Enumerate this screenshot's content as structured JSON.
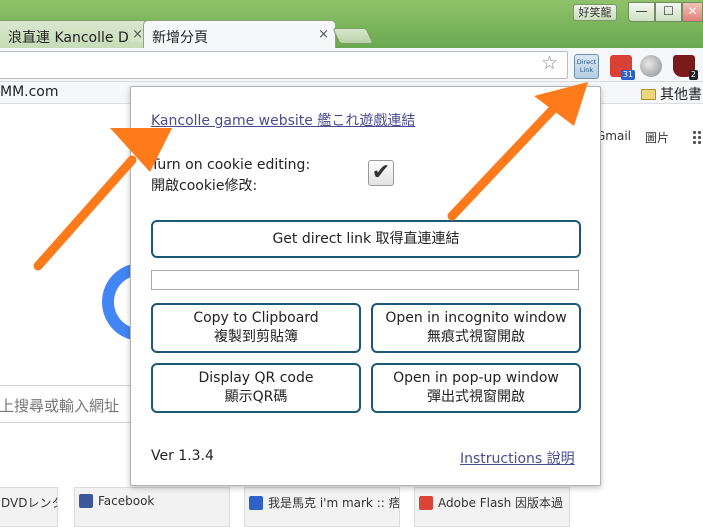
{
  "browser": {
    "tabs": [
      {
        "label": "浪直連 Kancolle D",
        "active": false
      },
      {
        "label": "新增分頁",
        "active": true
      }
    ],
    "user_name": "好笑龍",
    "close_symbol": "×",
    "window_controls": {
      "minimize": "—",
      "maximize": "☐",
      "close": "✕"
    },
    "star_glyph": "☆",
    "extensions": {
      "direct_link": "Direct Link",
      "calendar_badge": "31",
      "ublock_badge": "2"
    },
    "bookmarks": {
      "left_item": "MM.com",
      "right_item": "其他書"
    }
  },
  "new_tab_page": {
    "gmail_link": "Gmail",
    "images_link": "圖片",
    "search_placeholder": "上搜尋或輸入網址",
    "tiles": [
      {
        "label": "DVDレンタ",
        "favicon_color": "#d8d8d8"
      },
      {
        "label": "Facebook",
        "favicon_color": "#3b5998"
      },
      {
        "label": "我是馬克 i'm mark :: 痞",
        "favicon_color": "#2f62c8"
      },
      {
        "label": "Adobe Flash 因版本過",
        "favicon_color": "#db4437"
      }
    ]
  },
  "popup": {
    "title_link": "Kancolle game website 艦これ遊戲連結",
    "cookie_label_en": "Turn on cookie editing:",
    "cookie_label_zh": "開啟cookie修改:",
    "cookie_checked": true,
    "check_glyph": "✔",
    "direct_link_button": "Get direct link 取得直連連結",
    "link_field_value": "",
    "copy_button": {
      "en": "Copy to Clipboard",
      "zh": "複製到剪貼簿"
    },
    "incognito_button": {
      "en": "Open in incognito window",
      "zh": "無痕式視窗開啟"
    },
    "qr_button": {
      "en": "Display QR code",
      "zh": "顯示QR碼"
    },
    "popup_window_button": {
      "en": "Open in pop-up window",
      "zh": "彈出式視窗開啟"
    },
    "version": "Ver 1.3.4",
    "instructions_link": "Instructions 說明"
  },
  "colors": {
    "accent_border": "#1a5a78",
    "link": "#4b4b8f",
    "arrow": "#ff7a1a",
    "chrome_green": "#6aa84f"
  }
}
